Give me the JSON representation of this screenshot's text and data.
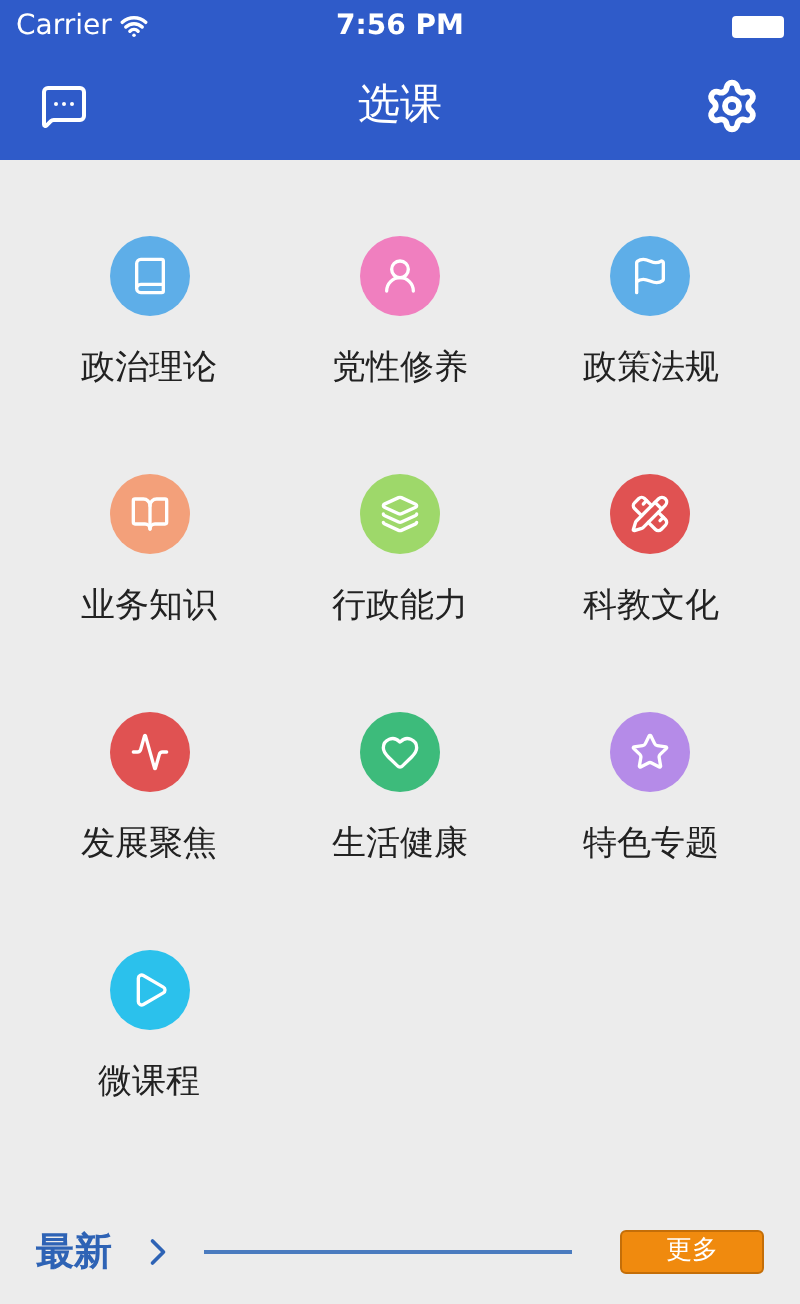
{
  "status_bar": {
    "carrier": "Carrier",
    "time": "7:56 PM"
  },
  "header": {
    "title": "选课"
  },
  "categories": [
    {
      "label": "政治理论",
      "kind": "book",
      "color": "#5eaee8"
    },
    {
      "label": "党性修养",
      "kind": "person",
      "color": "#f07fbf"
    },
    {
      "label": "政策法规",
      "kind": "flag",
      "color": "#5eaee8"
    },
    {
      "label": "业务知识",
      "kind": "open-book",
      "color": "#f3a07a"
    },
    {
      "label": "行政能力",
      "kind": "layers",
      "color": "#9ed86a"
    },
    {
      "label": "科教文化",
      "kind": "pencil-ruler",
      "color": "#e05252"
    },
    {
      "label": "发展聚焦",
      "kind": "trend",
      "color": "#e05252"
    },
    {
      "label": "生活健康",
      "kind": "heart",
      "color": "#3dbb7b"
    },
    {
      "label": "特色专题",
      "kind": "star",
      "color": "#b58be8"
    },
    {
      "label": "微课程",
      "kind": "play",
      "color": "#2bc1ec"
    }
  ],
  "latest": {
    "label": "最新",
    "more": "更多"
  }
}
